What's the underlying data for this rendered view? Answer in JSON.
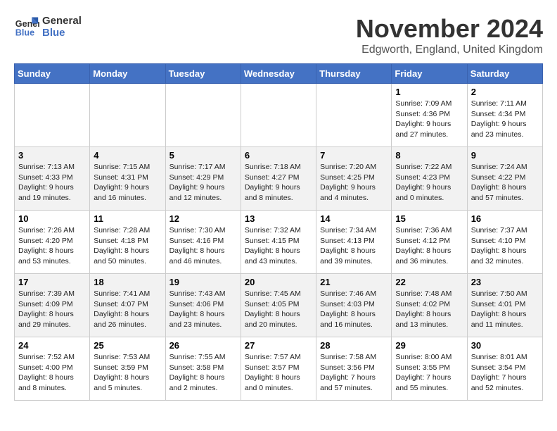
{
  "logo": {
    "line1": "General",
    "line2": "Blue"
  },
  "title": "November 2024",
  "location": "Edgworth, England, United Kingdom",
  "days_of_week": [
    "Sunday",
    "Monday",
    "Tuesday",
    "Wednesday",
    "Thursday",
    "Friday",
    "Saturday"
  ],
  "weeks": [
    [
      {
        "day": "",
        "info": ""
      },
      {
        "day": "",
        "info": ""
      },
      {
        "day": "",
        "info": ""
      },
      {
        "day": "",
        "info": ""
      },
      {
        "day": "",
        "info": ""
      },
      {
        "day": "1",
        "info": "Sunrise: 7:09 AM\nSunset: 4:36 PM\nDaylight: 9 hours\nand 27 minutes."
      },
      {
        "day": "2",
        "info": "Sunrise: 7:11 AM\nSunset: 4:34 PM\nDaylight: 9 hours\nand 23 minutes."
      }
    ],
    [
      {
        "day": "3",
        "info": "Sunrise: 7:13 AM\nSunset: 4:33 PM\nDaylight: 9 hours\nand 19 minutes."
      },
      {
        "day": "4",
        "info": "Sunrise: 7:15 AM\nSunset: 4:31 PM\nDaylight: 9 hours\nand 16 minutes."
      },
      {
        "day": "5",
        "info": "Sunrise: 7:17 AM\nSunset: 4:29 PM\nDaylight: 9 hours\nand 12 minutes."
      },
      {
        "day": "6",
        "info": "Sunrise: 7:18 AM\nSunset: 4:27 PM\nDaylight: 9 hours\nand 8 minutes."
      },
      {
        "day": "7",
        "info": "Sunrise: 7:20 AM\nSunset: 4:25 PM\nDaylight: 9 hours\nand 4 minutes."
      },
      {
        "day": "8",
        "info": "Sunrise: 7:22 AM\nSunset: 4:23 PM\nDaylight: 9 hours\nand 0 minutes."
      },
      {
        "day": "9",
        "info": "Sunrise: 7:24 AM\nSunset: 4:22 PM\nDaylight: 8 hours\nand 57 minutes."
      }
    ],
    [
      {
        "day": "10",
        "info": "Sunrise: 7:26 AM\nSunset: 4:20 PM\nDaylight: 8 hours\nand 53 minutes."
      },
      {
        "day": "11",
        "info": "Sunrise: 7:28 AM\nSunset: 4:18 PM\nDaylight: 8 hours\nand 50 minutes."
      },
      {
        "day": "12",
        "info": "Sunrise: 7:30 AM\nSunset: 4:16 PM\nDaylight: 8 hours\nand 46 minutes."
      },
      {
        "day": "13",
        "info": "Sunrise: 7:32 AM\nSunset: 4:15 PM\nDaylight: 8 hours\nand 43 minutes."
      },
      {
        "day": "14",
        "info": "Sunrise: 7:34 AM\nSunset: 4:13 PM\nDaylight: 8 hours\nand 39 minutes."
      },
      {
        "day": "15",
        "info": "Sunrise: 7:36 AM\nSunset: 4:12 PM\nDaylight: 8 hours\nand 36 minutes."
      },
      {
        "day": "16",
        "info": "Sunrise: 7:37 AM\nSunset: 4:10 PM\nDaylight: 8 hours\nand 32 minutes."
      }
    ],
    [
      {
        "day": "17",
        "info": "Sunrise: 7:39 AM\nSunset: 4:09 PM\nDaylight: 8 hours\nand 29 minutes."
      },
      {
        "day": "18",
        "info": "Sunrise: 7:41 AM\nSunset: 4:07 PM\nDaylight: 8 hours\nand 26 minutes."
      },
      {
        "day": "19",
        "info": "Sunrise: 7:43 AM\nSunset: 4:06 PM\nDaylight: 8 hours\nand 23 minutes."
      },
      {
        "day": "20",
        "info": "Sunrise: 7:45 AM\nSunset: 4:05 PM\nDaylight: 8 hours\nand 20 minutes."
      },
      {
        "day": "21",
        "info": "Sunrise: 7:46 AM\nSunset: 4:03 PM\nDaylight: 8 hours\nand 16 minutes."
      },
      {
        "day": "22",
        "info": "Sunrise: 7:48 AM\nSunset: 4:02 PM\nDaylight: 8 hours\nand 13 minutes."
      },
      {
        "day": "23",
        "info": "Sunrise: 7:50 AM\nSunset: 4:01 PM\nDaylight: 8 hours\nand 11 minutes."
      }
    ],
    [
      {
        "day": "24",
        "info": "Sunrise: 7:52 AM\nSunset: 4:00 PM\nDaylight: 8 hours\nand 8 minutes."
      },
      {
        "day": "25",
        "info": "Sunrise: 7:53 AM\nSunset: 3:59 PM\nDaylight: 8 hours\nand 5 minutes."
      },
      {
        "day": "26",
        "info": "Sunrise: 7:55 AM\nSunset: 3:58 PM\nDaylight: 8 hours\nand 2 minutes."
      },
      {
        "day": "27",
        "info": "Sunrise: 7:57 AM\nSunset: 3:57 PM\nDaylight: 8 hours\nand 0 minutes."
      },
      {
        "day": "28",
        "info": "Sunrise: 7:58 AM\nSunset: 3:56 PM\nDaylight: 7 hours\nand 57 minutes."
      },
      {
        "day": "29",
        "info": "Sunrise: 8:00 AM\nSunset: 3:55 PM\nDaylight: 7 hours\nand 55 minutes."
      },
      {
        "day": "30",
        "info": "Sunrise: 8:01 AM\nSunset: 3:54 PM\nDaylight: 7 hours\nand 52 minutes."
      }
    ]
  ]
}
